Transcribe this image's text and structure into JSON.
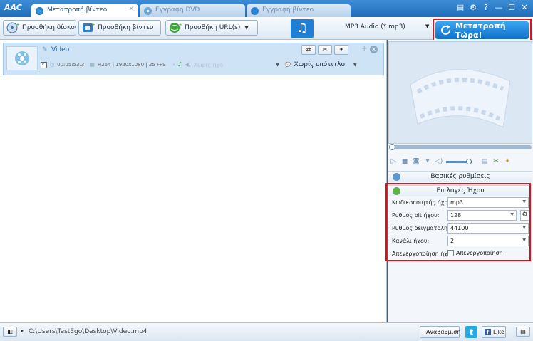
{
  "app": {
    "logo": "AAC"
  },
  "tabs": [
    {
      "label": "Μετατροπή βίντεο",
      "active": true
    },
    {
      "label": "Εγγραφή DVD",
      "active": false
    },
    {
      "label": "Εγγραφή βίντεο",
      "active": false
    }
  ],
  "window_controls": {
    "menu": "▤",
    "settings": "⚙",
    "help": "?",
    "minimize": "—",
    "maximize": "☐",
    "close": "✕"
  },
  "toolbar": {
    "add_disc": "Προσθήκη δίσκου CD",
    "add_video": "Προσθήκη βίντεο",
    "add_url": "Προσθήκη URL(s)",
    "format": "MP3 Audio (*.mp3)",
    "convert_now": "Μετατροπή Τώρα!"
  },
  "file": {
    "name": "Video",
    "duration": "00:05:53.3",
    "codec_info": "H264 | 1920x1080 | 25 FPS",
    "audio_track": "Χωρίς ήχο",
    "subtitle": "Χωρίς υπότιτλο"
  },
  "right_panel": {
    "basic_settings": "Βασικές ρυθμίσεις",
    "audio_options": "Επιλογές Ήχου",
    "options": [
      {
        "label": "Κωδικοποιητής ήχου",
        "value": "mp3"
      },
      {
        "label": "Ρυθμός bit ήχου:",
        "value": "128"
      },
      {
        "label": "Ρυθμός δειγματοληψίας",
        "value": "44100"
      },
      {
        "label": "Κανάλι ήχου:",
        "value": "2"
      },
      {
        "label": "Απενεργοποίηση ήχου",
        "value": "Απενεργοποίηση"
      }
    ]
  },
  "status": {
    "path": "C:\\Users\\TestEgo\\Desktop\\Video.mp4",
    "upgrade": "Αναβάθμιση",
    "like": "Like",
    "twitter": "t"
  },
  "colors": {
    "accent": "#1e7fd6",
    "highlight": "#e0101a",
    "selected_row": "#cfe3f7"
  }
}
